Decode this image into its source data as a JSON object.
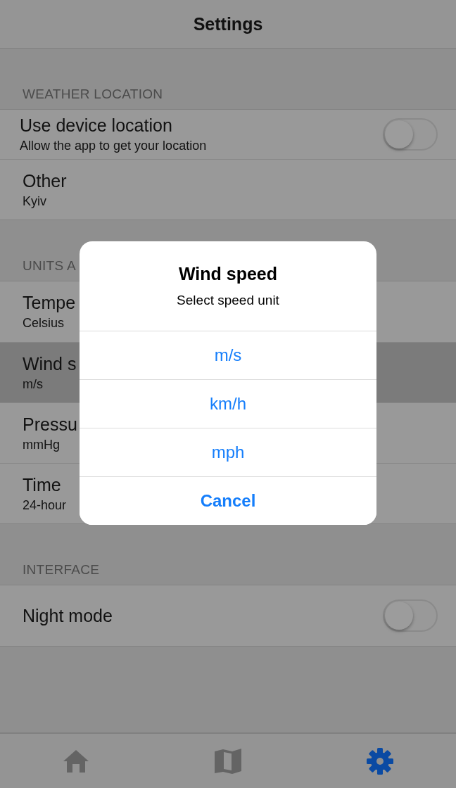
{
  "nav_bar": {
    "title": "Settings"
  },
  "sections": [
    {
      "header": "WEATHER LOCATION",
      "rows": [
        {
          "kind": "switch",
          "title": "Use device location",
          "subtitle": "Allow the app to get your location",
          "on": false,
          "highlighted": false
        },
        {
          "kind": "value",
          "title": "Other",
          "subtitle": "Kyiv",
          "highlighted": false
        }
      ]
    },
    {
      "header": "UNITS A",
      "rows": [
        {
          "kind": "value",
          "title": "Tempe",
          "subtitle": "Celsius",
          "highlighted": false
        },
        {
          "kind": "value",
          "title": "Wind s",
          "subtitle": "m/s",
          "highlighted": true
        },
        {
          "kind": "value",
          "title": "Pressu",
          "subtitle": "mmHg",
          "highlighted": false
        },
        {
          "kind": "value",
          "title": "Time",
          "subtitle": "24-hour",
          "highlighted": false
        }
      ]
    },
    {
      "header": "INTERFACE",
      "rows": [
        {
          "kind": "switch",
          "title": "Night mode",
          "on": false,
          "highlighted": false
        }
      ]
    }
  ],
  "dialog": {
    "title": "Wind speed",
    "message": "Select speed unit",
    "options": [
      {
        "label": "m/s",
        "kind": "option"
      },
      {
        "label": "km/h",
        "kind": "option"
      },
      {
        "label": "mph",
        "kind": "option"
      },
      {
        "label": "Cancel",
        "kind": "cancel"
      }
    ]
  },
  "tab_bar": [
    {
      "kind": "home",
      "selected": false
    },
    {
      "kind": "map",
      "selected": false
    },
    {
      "kind": "settings",
      "selected": true
    }
  ]
}
